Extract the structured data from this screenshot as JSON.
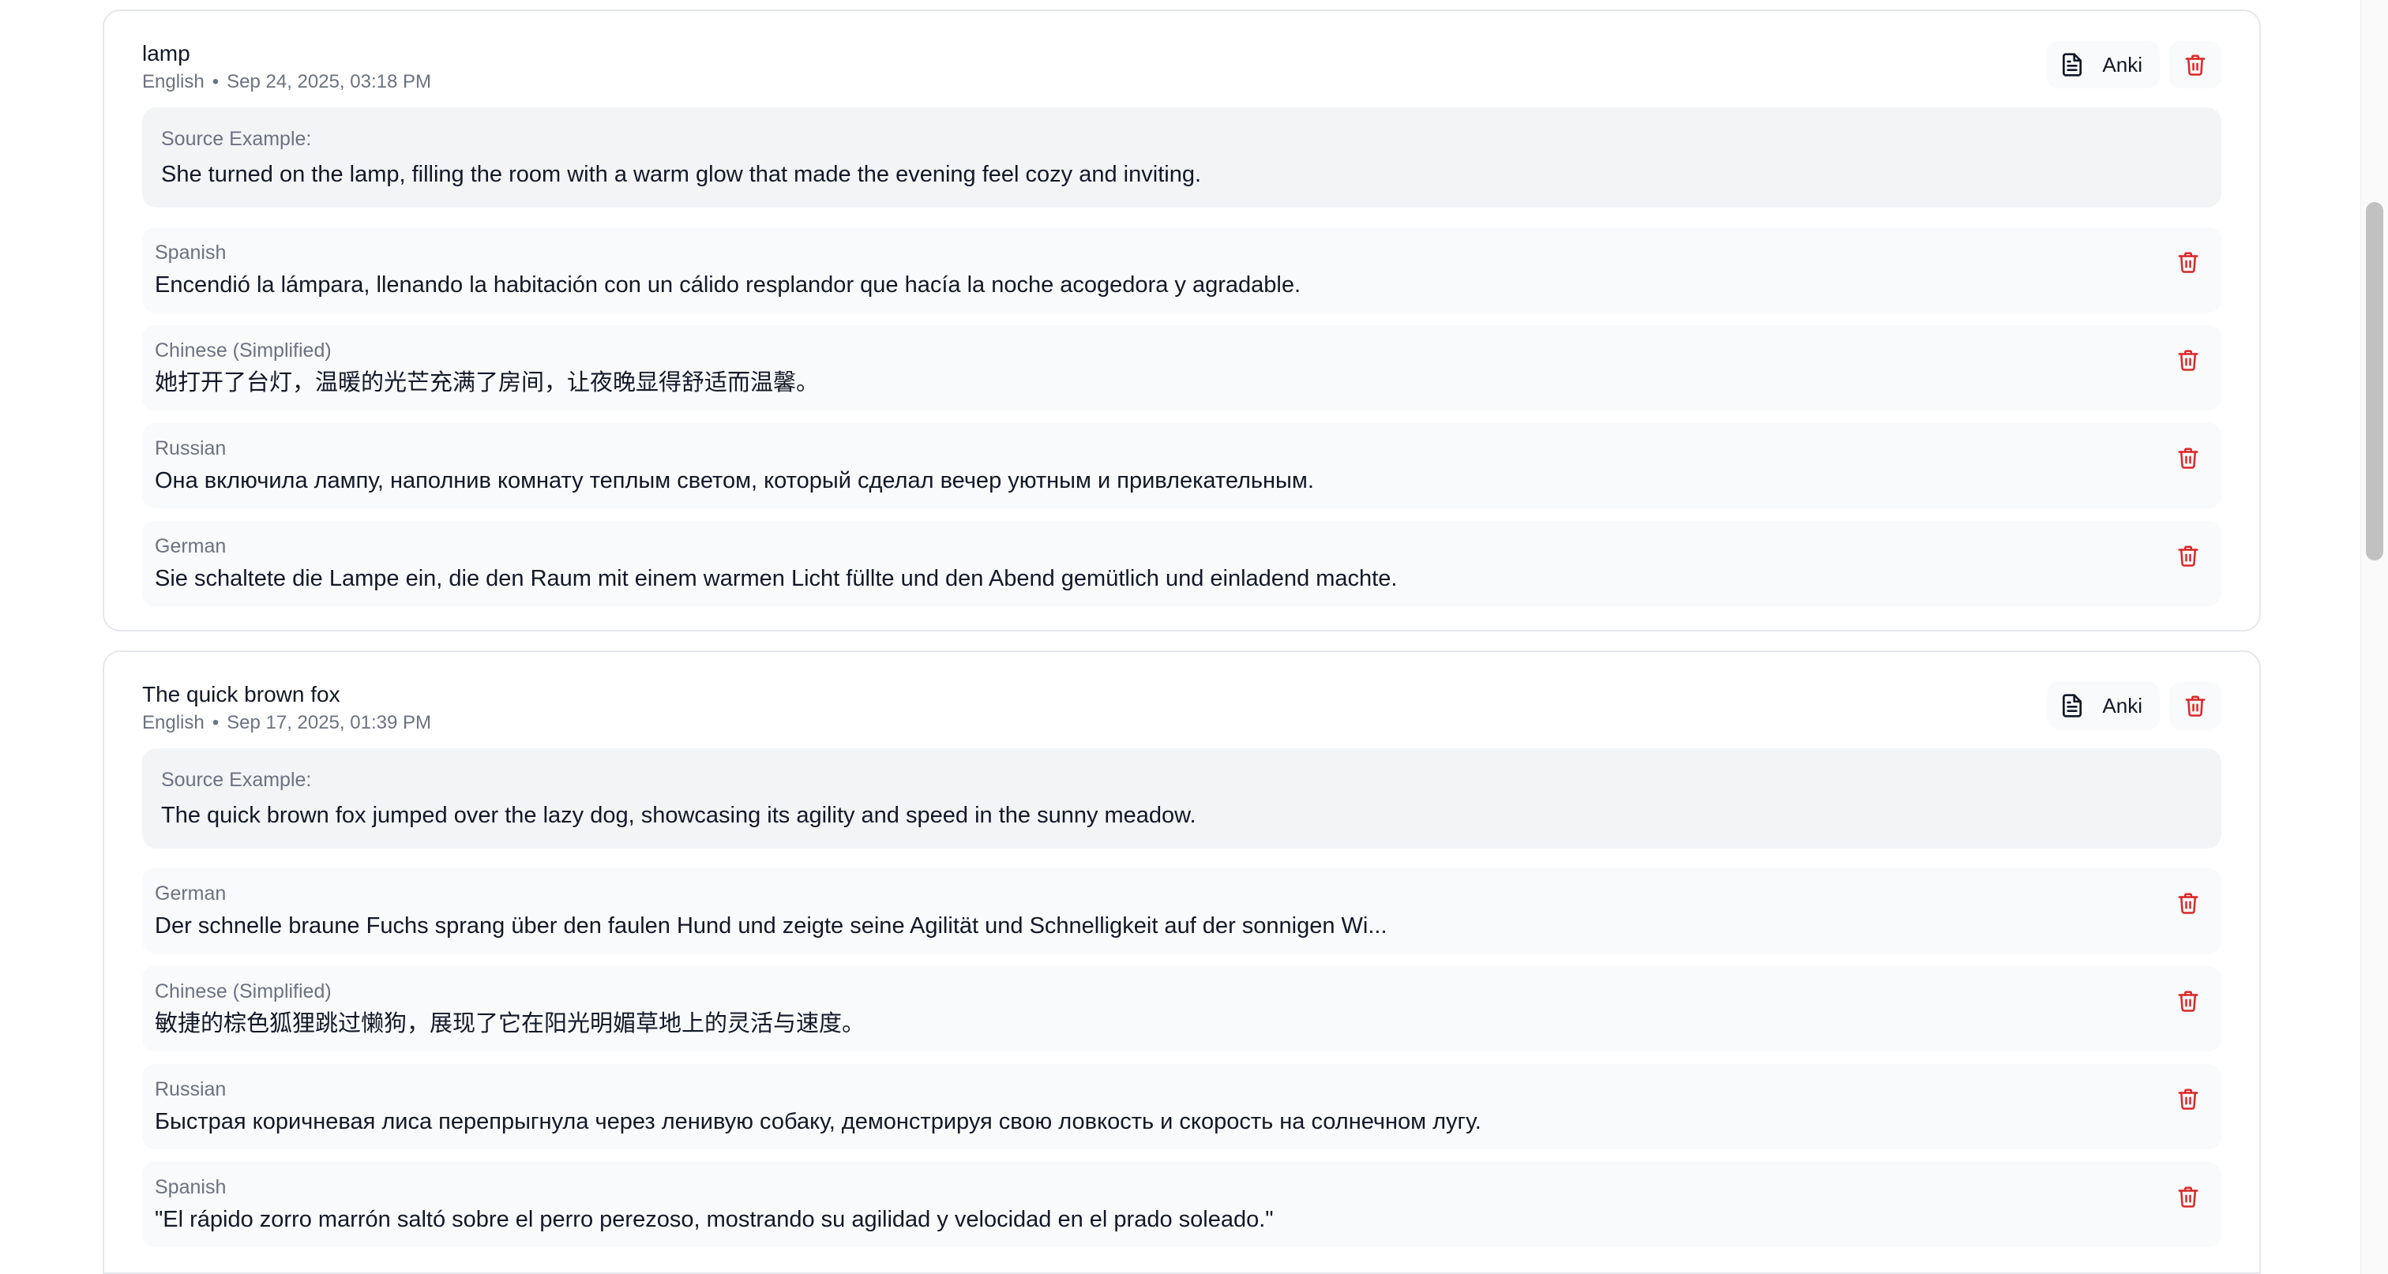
{
  "buttons": {
    "anki_label": "Anki"
  },
  "colors": {
    "trash": "#dc2626",
    "meta_text": "#6b7280",
    "source_bg": "#f3f4f6",
    "row_bg": "#f9fafb"
  },
  "icons": {
    "export": "file-text-icon",
    "delete": "trash-icon"
  },
  "cards": [
    {
      "title": "lamp",
      "language": "English",
      "separator": "•",
      "date": "Sep 24, 2025, 03:18 PM",
      "source_label": "Source Example:",
      "source_text": "She turned on the lamp, filling the room with a warm glow that made the evening feel cozy and inviting.",
      "translations": [
        {
          "language": "Spanish",
          "text": "Encendió la lámpara, llenando la habitación con un cálido resplandor que hacía la noche acogedora y agradable."
        },
        {
          "language": "Chinese (Simplified)",
          "text": "她打开了台灯，温暖的光芒充满了房间，让夜晚显得舒适而温馨。"
        },
        {
          "language": "Russian",
          "text": "Она включила лампу, наполнив комнату теплым светом, который сделал вечер уютным и привлекательным."
        },
        {
          "language": "German",
          "text": "Sie schaltete die Lampe ein, die den Raum mit einem warmen Licht füllte und den Abend gemütlich und einladend machte."
        }
      ]
    },
    {
      "title": "The quick brown fox",
      "language": "English",
      "separator": "•",
      "date": "Sep 17, 2025, 01:39 PM",
      "source_label": "Source Example:",
      "source_text": "The quick brown fox jumped over the lazy dog, showcasing its agility and speed in the sunny meadow.",
      "translations": [
        {
          "language": "German",
          "text": "Der schnelle braune Fuchs sprang über den faulen Hund und zeigte seine Agilität und Schnelligkeit auf der sonnigen Wi..."
        },
        {
          "language": "Chinese (Simplified)",
          "text": "敏捷的棕色狐狸跳过懒狗，展现了它在阳光明媚草地上的灵活与速度。"
        },
        {
          "language": "Russian",
          "text": "Быстрая коричневая лиса перепрыгнула через ленивую собаку, демонстрируя свою ловкость и скорость на солнечном лугу."
        },
        {
          "language": "Spanish",
          "text": "\"El rápido zorro marrón saltó sobre el perro perezoso, mostrando su agilidad y velocidad en el prado soleado.\""
        }
      ]
    }
  ]
}
